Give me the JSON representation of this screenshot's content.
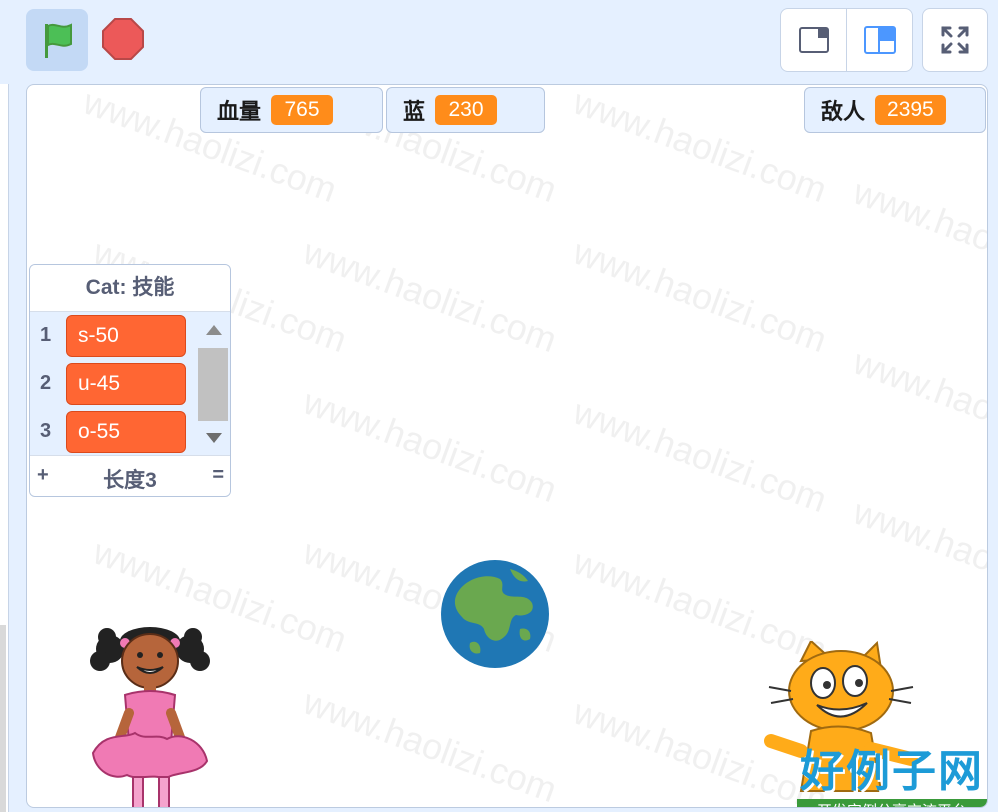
{
  "toolbar": {
    "green_flag_icon": "green-flag-icon",
    "stop_icon": "stop-sign-icon",
    "small_stage_icon": "small-stage-layout-icon",
    "normal_stage_icon": "normal-stage-layout-icon",
    "fullscreen_icon": "fullscreen-icon"
  },
  "monitors": [
    {
      "label": "血量",
      "value": "765"
    },
    {
      "label": "蓝",
      "value": "230"
    },
    {
      "label": "敌人",
      "value": "2395"
    }
  ],
  "list_monitor": {
    "title": "Cat: 技能",
    "items": [
      {
        "index": "1",
        "value": "s-50"
      },
      {
        "index": "2",
        "value": "u-45"
      },
      {
        "index": "3",
        "value": "o-55"
      }
    ],
    "add_symbol": "+",
    "length_label": "长度3",
    "resize_symbol": "="
  },
  "watermark": {
    "text": "www.haolizi.com",
    "logo_main": "好例子网",
    "logo_sub": "开发实例分享交流平台"
  },
  "colors": {
    "accent": "#ff8c1a",
    "list_item": "#ff6633",
    "flag_green": "#4cbf56",
    "stop_red": "#ec5959",
    "panel_bg": "#e5f0ff"
  }
}
